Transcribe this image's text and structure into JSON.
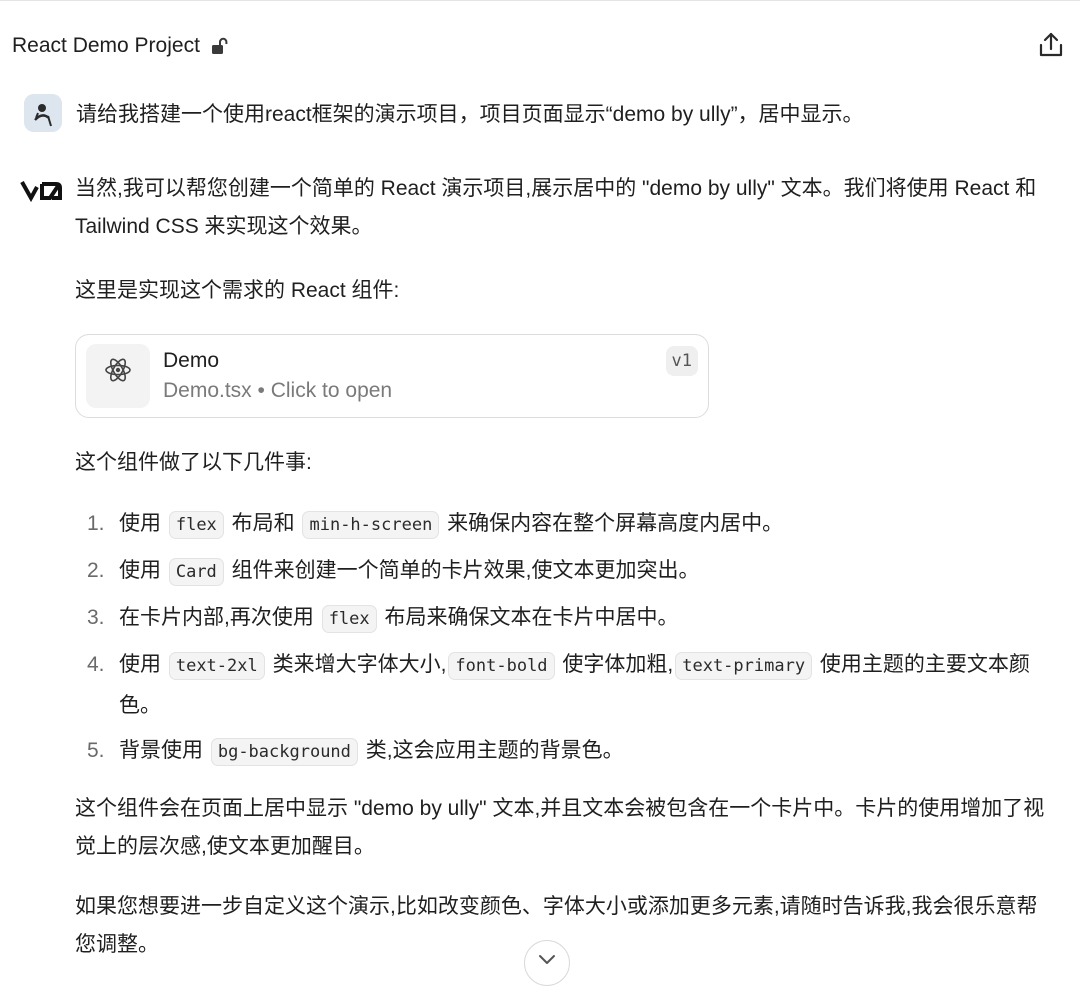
{
  "header": {
    "title": "React Demo Project"
  },
  "user_message": {
    "text": "请给我搭建一个使用react框架的演示项目，项目页面显示“demo by ully”，居中显示。"
  },
  "assistant": {
    "intro": "当然,我可以帮您创建一个简单的 React 演示项目,展示居中的 \"demo by ully\" 文本。我们将使用 React 和 Tailwind CSS 来实现这个效果。",
    "here_is": "这里是实现这个需求的 React 组件:",
    "artifact": {
      "title": "Demo",
      "subtitle": "Demo.tsx • Click to open",
      "version": "v1"
    },
    "does_intro": "这个组件做了以下几件事:",
    "steps": [
      {
        "num": "1.",
        "a": "使用",
        "code1": "flex",
        "b": "布局和",
        "code2": "min-h-screen",
        "c": "来确保内容在整个屏幕高度内居中。"
      },
      {
        "num": "2.",
        "a": "使用",
        "code1": "Card",
        "b": "组件来创建一个简单的卡片效果,使文本更加突出。"
      },
      {
        "num": "3.",
        "a": "在卡片内部,再次使用",
        "code1": "flex",
        "b": "布局来确保文本在卡片中居中。"
      },
      {
        "num": "4.",
        "a": "使用",
        "code1": "text-2xl",
        "b": "类来增大字体大小,",
        "code2": "font-bold",
        "c": "使字体加粗,",
        "code3": "text-primary",
        "d": "使用主题的主要文本颜色。"
      },
      {
        "num": "5.",
        "a": "背景使用",
        "code1": "bg-background",
        "b": "类,这会应用主题的背景色。"
      }
    ],
    "summary": "这个组件会在页面上居中显示 \"demo by ully\" 文本,并且文本会被包含在一个卡片中。卡片的使用增加了视觉上的层次感,使文本更加醒目。",
    "closing": "如果您想要进一步自定义这个演示,比如改变颜色、字体大小或添加更多元素,请随时告诉我,我会很乐意帮您调整。"
  },
  "icons": {
    "lock": "lock-open-icon",
    "share": "share-icon",
    "react": "react-atom-icon",
    "scroll": "chevron-down-icon"
  }
}
